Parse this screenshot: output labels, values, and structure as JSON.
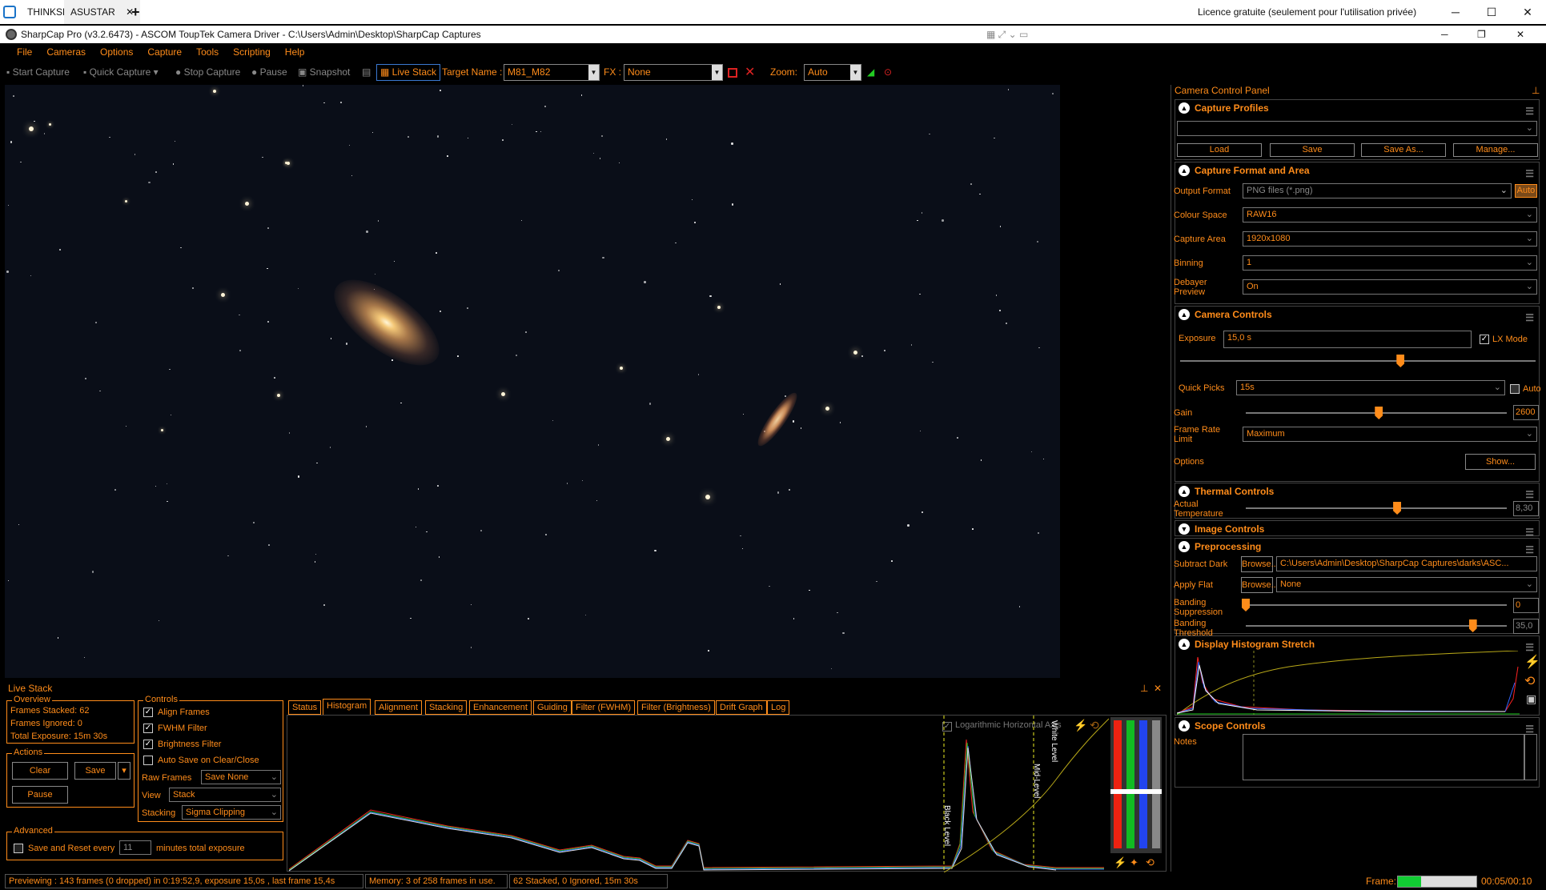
{
  "remote_tabs": [
    "THINKSKY",
    "ASUSTAR"
  ],
  "remote_add": "+",
  "licence": "Licence gratuite (seulement pour l'utilisation privée)",
  "window_title": "SharpCap Pro (v3.2.6473) - ASCOM ToupTek Camera Driver - C:\\Users\\Admin\\Desktop\\SharpCap Captures",
  "menu": [
    "File",
    "Cameras",
    "Options",
    "Capture",
    "Tools",
    "Scripting",
    "Help"
  ],
  "toolbar": {
    "start_capture": "Start Capture",
    "quick_capture": "Quick Capture",
    "stop_capture": "Stop Capture",
    "pause": "Pause",
    "snapshot": "Snapshot",
    "live_stack": "Live Stack",
    "target_name_label": "Target Name :",
    "target_name": "M81_M82",
    "fx_label": "FX :",
    "fx_value": "None",
    "zoom_label": "Zoom:",
    "zoom_value": "Auto"
  },
  "panel": {
    "title": "Camera Control Panel",
    "capture_profiles": {
      "title": "Capture Profiles",
      "buttons": [
        "Load",
        "Save",
        "Save As...",
        "Manage..."
      ]
    },
    "capture_format": {
      "title": "Capture Format and Area",
      "output_format_label": "Output Format",
      "output_format": "PNG files (*.png)",
      "auto": "Auto",
      "colour_space_label": "Colour Space",
      "colour_space": "RAW16",
      "capture_area_label": "Capture Area",
      "capture_area": "1920x1080",
      "binning_label": "Binning",
      "binning": "1",
      "debayer_label_1": "Debayer",
      "debayer_label_2": "Preview",
      "debayer": "On"
    },
    "camera_controls": {
      "title": "Camera Controls",
      "exposure_label": "Exposure",
      "exposure": "15,0 s",
      "lx_mode": "LX Mode",
      "exposure_level": 0.62,
      "quick_picks_label": "Quick Picks",
      "quick_picks": "15s",
      "auto": "Auto",
      "gain_label": "Gain",
      "gain": "2600",
      "gain_level": 0.51,
      "frame_rate_label_1": "Frame Rate",
      "frame_rate_label_2": "Limit",
      "frame_rate": "Maximum",
      "options_label": "Options",
      "show_button": "Show..."
    },
    "thermal": {
      "title": "Thermal Controls",
      "temp_label_1": "Actual",
      "temp_label_2": "Temperature",
      "temp": "8,30",
      "temp_level": 0.58
    },
    "image_controls": {
      "title": "Image Controls"
    },
    "preprocessing": {
      "title": "Preprocessing",
      "subtract_dark_label": "Subtract Dark",
      "browse": "Browse...",
      "dark_path": "C:\\Users\\Admin\\Desktop\\SharpCap Captures\\darks\\ASC...",
      "apply_flat_label": "Apply Flat",
      "flat": "None",
      "banding_supp_label_1": "Banding",
      "banding_supp_label_2": "Suppression",
      "banding_supp": "0",
      "banding_thr_label_1": "Banding",
      "banding_thr_label_2": "Threshold",
      "banding_thr": "35,0",
      "banding_thr_level": 0.87
    },
    "histogram_stretch": {
      "title": "Display Histogram Stretch"
    },
    "scope_controls": {
      "title": "Scope Controls",
      "notes_label": "Notes"
    }
  },
  "live_stack": {
    "title": "Live Stack",
    "overview": {
      "title": "Overview",
      "frames_stacked": "Frames Stacked:  62",
      "frames_ignored": "Frames Ignored:  0",
      "total_exposure": "Total Exposure:    15m 30s"
    },
    "actions": {
      "title": "Actions",
      "clear": "Clear",
      "save": "Save",
      "pause": "Pause"
    },
    "advanced": {
      "title": "Advanced",
      "save_reset": "Save and Reset every",
      "minutes": "11",
      "minutes_label": "minutes total exposure"
    },
    "controls": {
      "title": "Controls",
      "align": "Align Frames",
      "fwhm": "FWHM Filter",
      "brightness": "Brightness Filter",
      "auto_save": "Auto Save on Clear/Close",
      "raw_frames_label": "Raw Frames",
      "raw_frames": "Save None",
      "view_label": "View",
      "view": "Stack",
      "stacking_label": "Stacking",
      "stacking": "Sigma Clipping"
    },
    "tabs": [
      "Status",
      "Histogram",
      "Alignment",
      "Stacking",
      "Enhancement",
      "Guiding",
      "Filter (FWHM)",
      "Filter (Brightness)",
      "Drift Graph",
      "Log"
    ],
    "histogram": {
      "log_axis": "Logarithmic Horizontal Axis",
      "black_level": "Black Level",
      "mid_level": "Mid-Level",
      "white_level": "White Level"
    }
  },
  "status": {
    "previewing": "Previewing : 143 frames (0 dropped) in 0:19:52,9, exposure 15,0s , last frame 15,4s",
    "memory": "Memory: 3 of 258 frames in use.",
    "stacked": "62 Stacked, 0 Ignored, 15m 30s",
    "frame_label": "Frame:",
    "frame_time": "00:05/00:10",
    "frame_progress": 0.3
  }
}
